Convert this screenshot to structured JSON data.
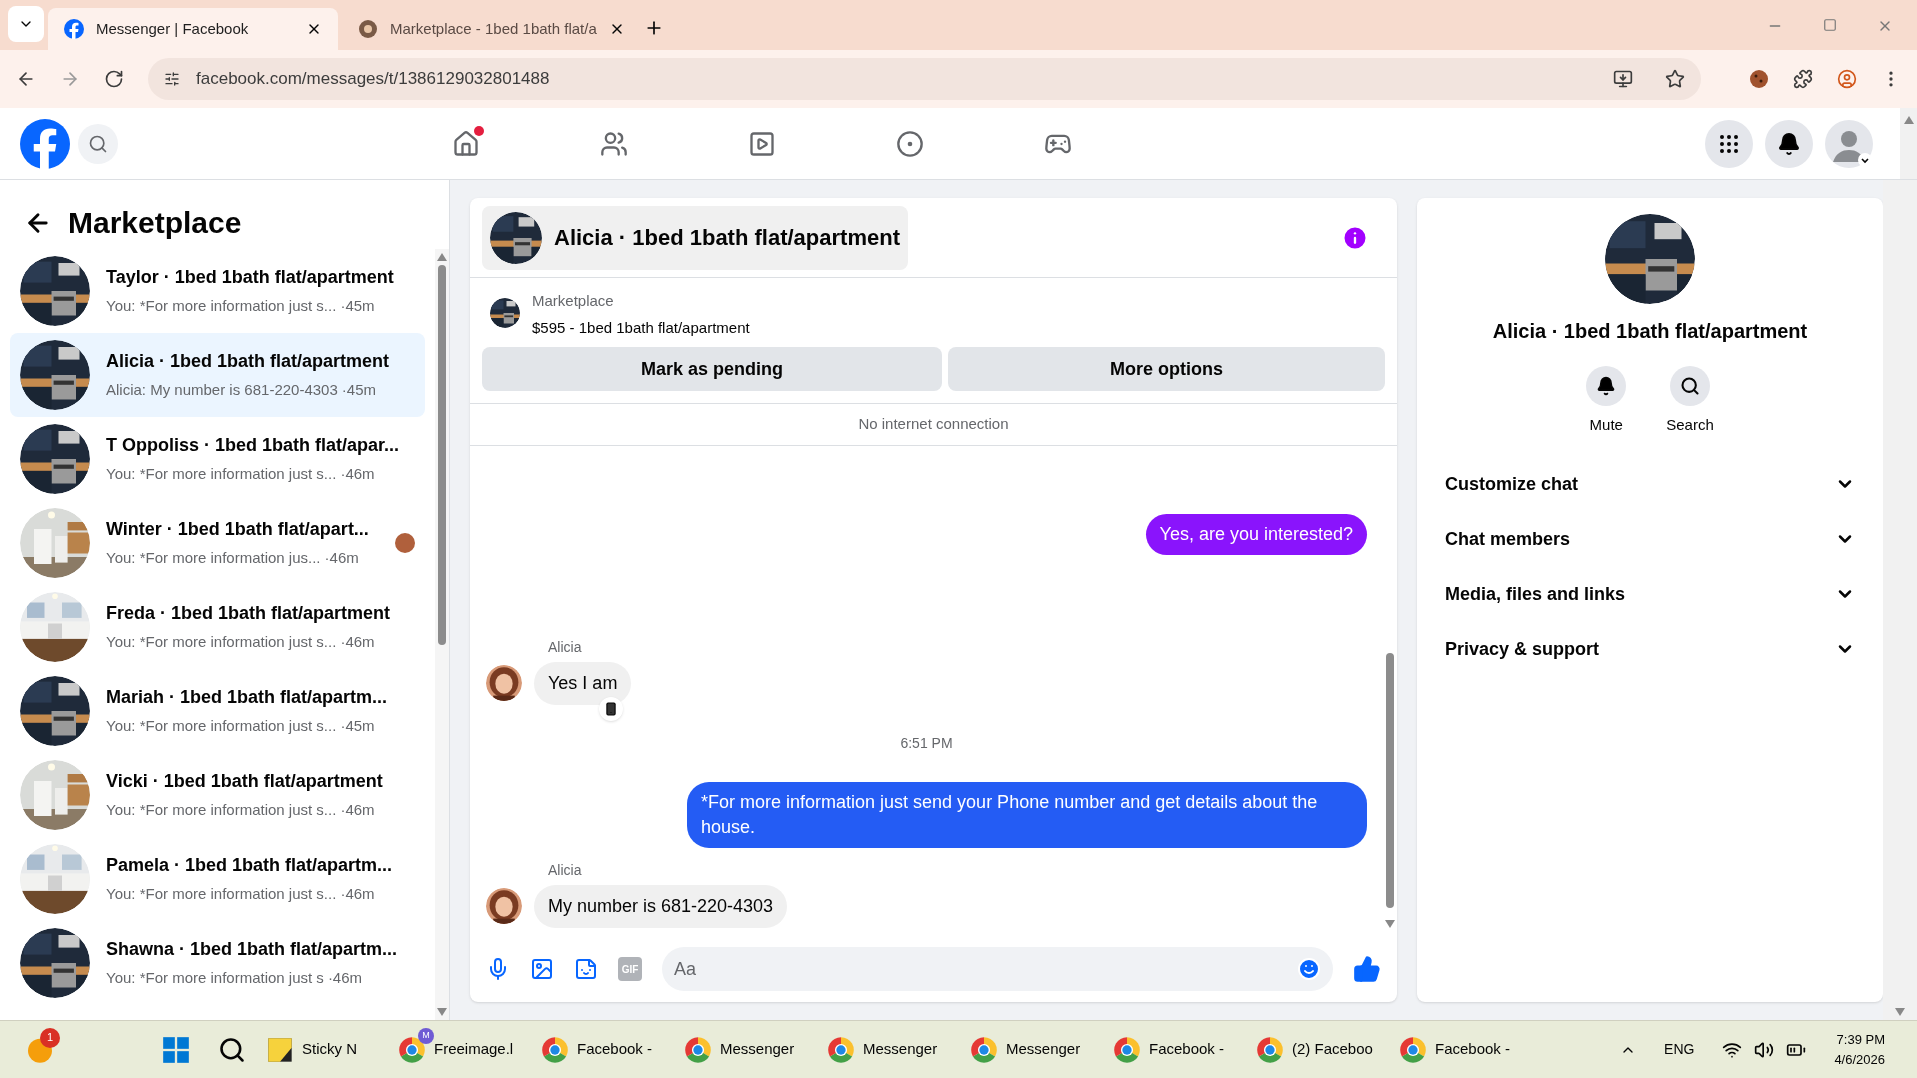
{
  "browser": {
    "tabs": [
      {
        "title": "Messenger | Facebook",
        "selected": true
      },
      {
        "title": "Marketplace - 1bed 1bath flat/a",
        "selected": false
      }
    ],
    "url": "facebook.com/messages/t/1386129032801488"
  },
  "sidebar": {
    "title": "Marketplace",
    "conversations": [
      {
        "name": "Taylor · 1bed 1bath flat/apartment",
        "preview": "You: *For more information just s...",
        "time": "·45m",
        "selected": false,
        "seen": false
      },
      {
        "name": "Alicia · 1bed 1bath flat/apartment",
        "preview": "Alicia: My number is 681-220-4303",
        "time": "·45m",
        "selected": true,
        "seen": false
      },
      {
        "name": "T Oppoliss · 1bed 1bath flat/apar...",
        "preview": "You: *For more information just s...",
        "time": "·46m",
        "selected": false,
        "seen": false
      },
      {
        "name": "Winter · 1bed 1bath flat/apart...",
        "preview": "You: *For more information jus...",
        "time": "·46m",
        "selected": false,
        "seen": true
      },
      {
        "name": "Freda · 1bed 1bath flat/apartment",
        "preview": "You: *For more information just s...",
        "time": "·46m",
        "selected": false,
        "seen": false
      },
      {
        "name": "Mariah · 1bed 1bath flat/apartm...",
        "preview": "You: *For more information just s...",
        "time": "·45m",
        "selected": false,
        "seen": false
      },
      {
        "name": "Vicki · 1bed 1bath flat/apartment",
        "preview": "You: *For more information just s...",
        "time": "·46m",
        "selected": false,
        "seen": false
      },
      {
        "name": "Pamela · 1bed 1bath flat/apartm...",
        "preview": "You: *For more information just s...",
        "time": "·46m",
        "selected": false,
        "seen": false
      },
      {
        "name": "Shawna · 1bed 1bath flat/apartm...",
        "preview": "You: *For more information just s",
        "time": "·46m",
        "selected": false,
        "seen": false
      }
    ]
  },
  "chat": {
    "title": "Alicia · 1bed 1bath flat/apartment",
    "listing": {
      "source": "Marketplace",
      "summary": "$595 - 1bed 1bath flat/apartment"
    },
    "buttons": [
      "Mark as pending",
      "More options"
    ],
    "notice": "No internet connection",
    "messages": [
      {
        "kind": "sent",
        "text": "Yes, are you interested?",
        "color": "#8a14fc"
      },
      {
        "kind": "received",
        "sender": "Alicia",
        "text": "Yes I am",
        "reaction": true
      },
      {
        "kind": "timestamp",
        "text": "6:51 PM"
      },
      {
        "kind": "sent",
        "text": "*For more information just send your Phone number and  get details about the house.",
        "color": "#245cf4"
      },
      {
        "kind": "received",
        "sender": "Alicia",
        "text": "My number is 681-220-4303",
        "reaction": false
      }
    ],
    "composer": {
      "gif_label": "GIF",
      "placeholder": "Aa"
    }
  },
  "details": {
    "name": "Alicia · 1bed 1bath flat/apartment",
    "actions": [
      "Mute",
      "Search"
    ],
    "sections": [
      {
        "label": "Customize chat",
        "expanded": false
      },
      {
        "label": "Chat members",
        "expanded": false
      },
      {
        "label": "Media, files and links",
        "expanded": false
      },
      {
        "label": "Privacy & support",
        "expanded": false
      }
    ]
  },
  "taskbar": {
    "start_badge": "1",
    "items": [
      {
        "label": "Sticky N",
        "kind": "sticky"
      },
      {
        "label": "Freeimage.l",
        "kind": "browser",
        "badge": "M"
      },
      {
        "label": "Facebook -",
        "kind": "browser"
      },
      {
        "label": "Messenger",
        "kind": "browser"
      },
      {
        "label": "Messenger",
        "kind": "browser"
      },
      {
        "label": "Messenger",
        "kind": "browser"
      },
      {
        "label": "Facebook -",
        "kind": "browser"
      },
      {
        "label": "(2) Faceboo",
        "kind": "browser"
      },
      {
        "label": "Facebook -",
        "kind": "browser"
      }
    ],
    "language": "ENG",
    "time": "7:39 PM",
    "date": "4/6/2026"
  }
}
